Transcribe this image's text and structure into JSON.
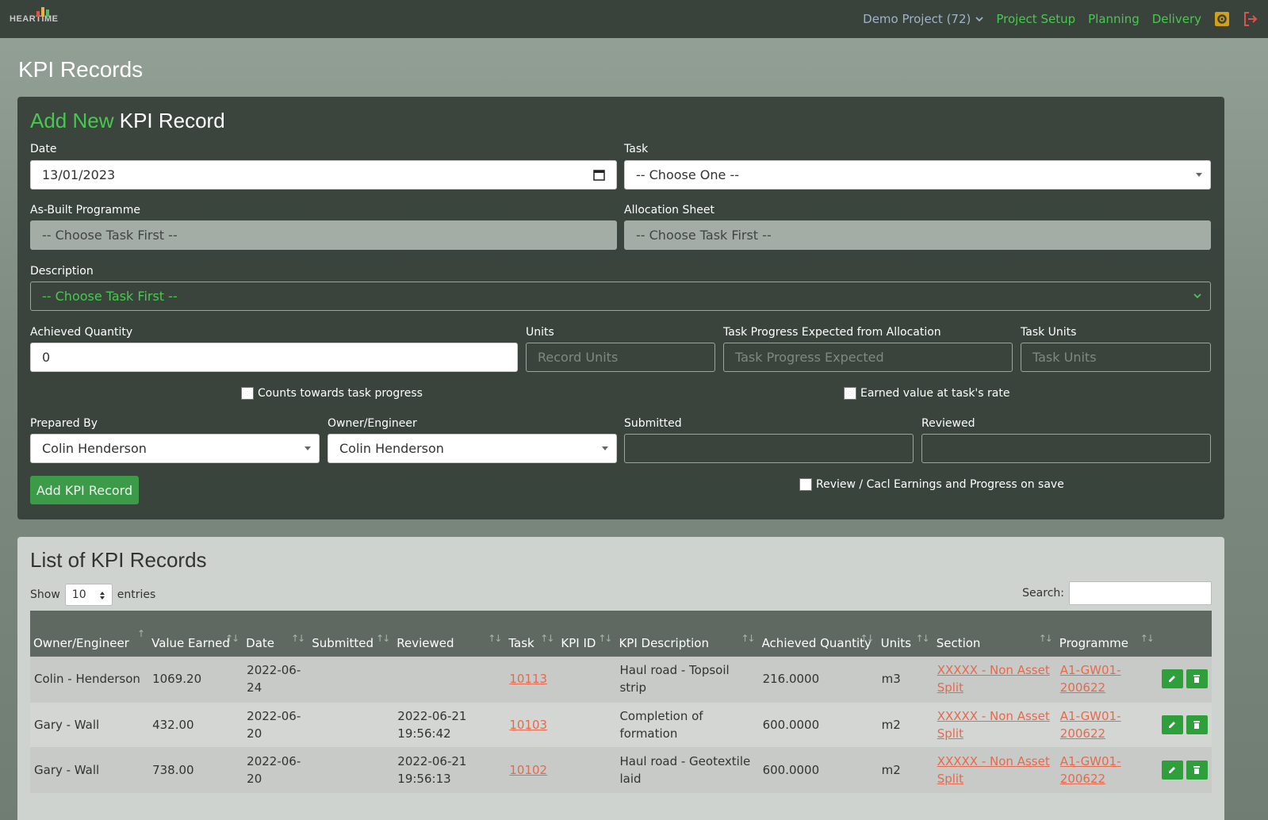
{
  "nav": {
    "logo_text": "HEARTIME",
    "project": "Demo Project (72)",
    "links": [
      "Project Setup",
      "Planning",
      "Delivery"
    ],
    "icons": [
      "settings-icon",
      "logout-icon"
    ]
  },
  "page": {
    "title": "KPI Records"
  },
  "form": {
    "heading_green": "Add New",
    "heading_rest": " KPI Record",
    "date_label": "Date",
    "date_value": "13/01/2023",
    "task_label": "Task",
    "task_value": "-- Choose One --",
    "asbuilt_label": "As-Built Programme",
    "asbuilt_value": "-- Choose Task First --",
    "allocation_label": "Allocation Sheet",
    "allocation_value": "-- Choose Task First --",
    "description_label": "Description",
    "description_value": "-- Choose Task First --",
    "achieved_label": "Achieved Quantity",
    "achieved_value": "0",
    "units_label": "Units",
    "units_placeholder": "Record Units",
    "progress_label": "Task Progress Expected from Allocation",
    "progress_placeholder": "Task Progress Expected",
    "taskunits_label": "Task Units",
    "taskunits_placeholder": "Task Units",
    "counts_label": "Counts towards task progress",
    "earned_label": "Earned value at task's rate",
    "prepared_label": "Prepared By",
    "prepared_value": "Colin Henderson",
    "owner_label": "Owner/Engineer",
    "owner_value": "Colin Henderson",
    "submitted_label": "Submitted",
    "reviewed_label": "Reviewed",
    "review_calc_label": "Review / Cacl Earnings and Progress on save",
    "add_button": "Add KPI Record"
  },
  "list": {
    "heading": "List of KPI Records",
    "show_label": "Show",
    "show_value": "10",
    "entries_label": "entries",
    "search_label": "Search:",
    "columns": [
      "Owner/Engineer",
      "Value Earned",
      "Date",
      "Submitted",
      "Reviewed",
      "Task",
      "KPI ID",
      "KPI Description",
      "Achieved Quantity",
      "Units",
      "Section",
      "Programme"
    ],
    "rows": [
      {
        "owner": "Colin - Henderson",
        "value": "1069.20",
        "date": "2022-06-24",
        "submitted": "",
        "reviewed": "",
        "task": "10113",
        "kpi_id": "",
        "desc": "Haul road - Topsoil strip",
        "qty": "216.0000",
        "units": "m3",
        "section": "XXXXX - Non Asset Split",
        "programme": "A1-GW01-200622"
      },
      {
        "owner": "Gary - Wall",
        "value": "432.00",
        "date": "2022-06-20",
        "submitted": "",
        "reviewed": "2022-06-21 19:56:42",
        "task": "10103",
        "kpi_id": "",
        "desc": "Completion of formation",
        "qty": "600.0000",
        "units": "m2",
        "section": "XXXXX - Non Asset Split",
        "programme": "A1-GW01-200622"
      },
      {
        "owner": "Gary - Wall",
        "value": "738.00",
        "date": "2022-06-20",
        "submitted": "",
        "reviewed": "2022-06-21 19:56:13",
        "task": "10102",
        "kpi_id": "",
        "desc": "Haul road - Geotextile laid",
        "qty": "600.0000",
        "units": "m2",
        "section": "XXXXX - Non Asset Split",
        "programme": "A1-GW01-200622"
      }
    ]
  }
}
